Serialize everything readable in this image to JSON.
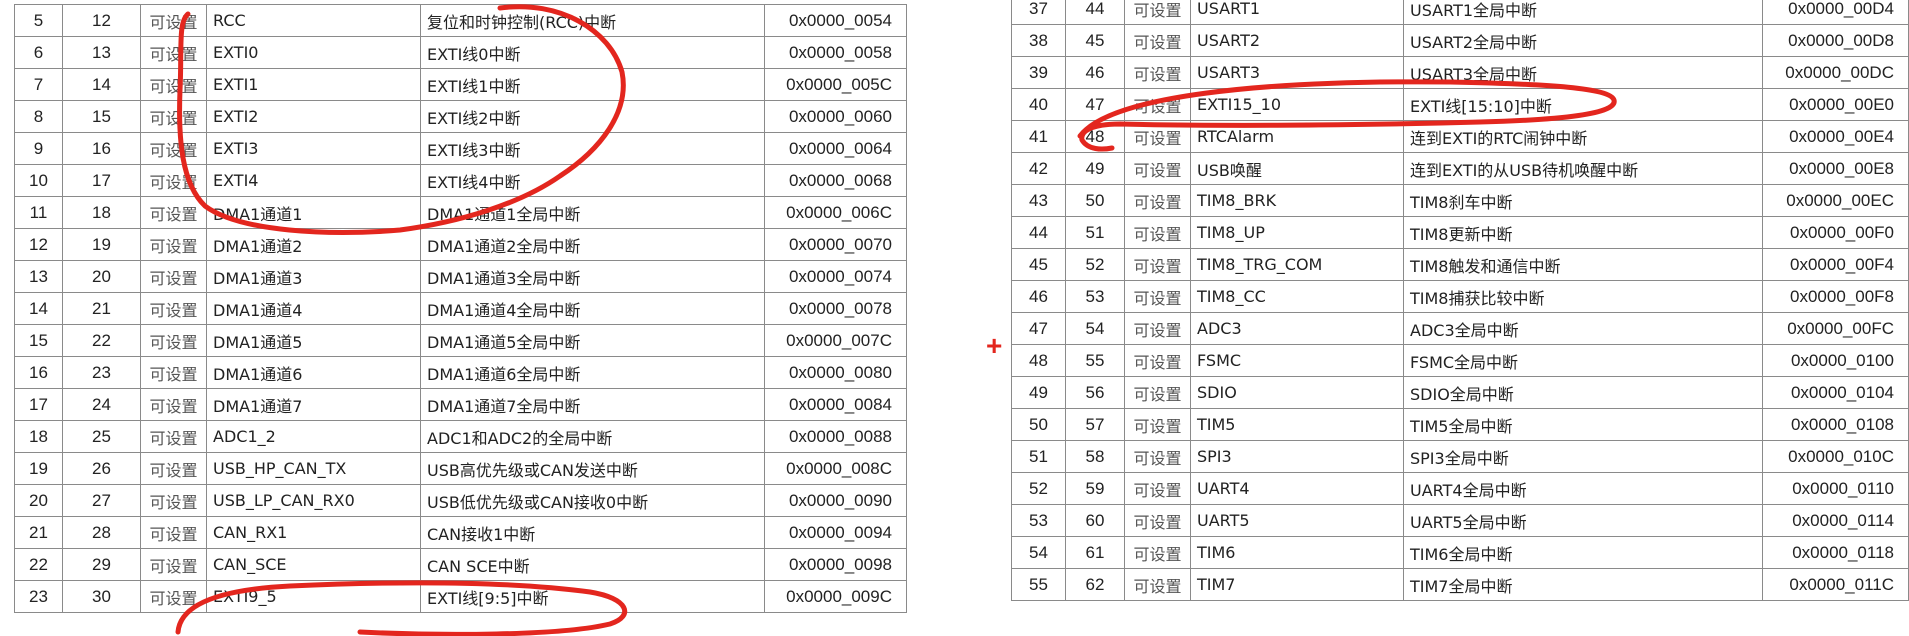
{
  "left_table": {
    "rows": [
      {
        "pos": "5",
        "prio": "12",
        "type": "可设置",
        "name": "RCC",
        "desc": "复位和时钟控制(RCC)中断",
        "addr": "0x0000_0054"
      },
      {
        "pos": "6",
        "prio": "13",
        "type": "可设置",
        "name": "EXTI0",
        "desc": "EXTI线0中断",
        "addr": "0x0000_0058"
      },
      {
        "pos": "7",
        "prio": "14",
        "type": "可设置",
        "name": "EXTI1",
        "desc": "EXTI线1中断",
        "addr": "0x0000_005C"
      },
      {
        "pos": "8",
        "prio": "15",
        "type": "可设置",
        "name": "EXTI2",
        "desc": "EXTI线2中断",
        "addr": "0x0000_0060"
      },
      {
        "pos": "9",
        "prio": "16",
        "type": "可设置",
        "name": "EXTI3",
        "desc": "EXTI线3中断",
        "addr": "0x0000_0064"
      },
      {
        "pos": "10",
        "prio": "17",
        "type": "可设置",
        "name": "EXTI4",
        "desc": "EXTI线4中断",
        "addr": "0x0000_0068"
      },
      {
        "pos": "11",
        "prio": "18",
        "type": "可设置",
        "name": "DMA1通道1",
        "desc": "DMA1通道1全局中断",
        "addr": "0x0000_006C"
      },
      {
        "pos": "12",
        "prio": "19",
        "type": "可设置",
        "name": "DMA1通道2",
        "desc": "DMA1通道2全局中断",
        "addr": "0x0000_0070"
      },
      {
        "pos": "13",
        "prio": "20",
        "type": "可设置",
        "name": "DMA1通道3",
        "desc": "DMA1通道3全局中断",
        "addr": "0x0000_0074"
      },
      {
        "pos": "14",
        "prio": "21",
        "type": "可设置",
        "name": "DMA1通道4",
        "desc": "DMA1通道4全局中断",
        "addr": "0x0000_0078"
      },
      {
        "pos": "15",
        "prio": "22",
        "type": "可设置",
        "name": "DMA1通道5",
        "desc": "DMA1通道5全局中断",
        "addr": "0x0000_007C"
      },
      {
        "pos": "16",
        "prio": "23",
        "type": "可设置",
        "name": "DMA1通道6",
        "desc": "DMA1通道6全局中断",
        "addr": "0x0000_0080"
      },
      {
        "pos": "17",
        "prio": "24",
        "type": "可设置",
        "name": "DMA1通道7",
        "desc": "DMA1通道7全局中断",
        "addr": "0x0000_0084"
      },
      {
        "pos": "18",
        "prio": "25",
        "type": "可设置",
        "name": "ADC1_2",
        "desc": "ADC1和ADC2的全局中断",
        "addr": "0x0000_0088"
      },
      {
        "pos": "19",
        "prio": "26",
        "type": "可设置",
        "name": "USB_HP_CAN_TX",
        "desc": "USB高优先级或CAN发送中断",
        "addr": "0x0000_008C"
      },
      {
        "pos": "20",
        "prio": "27",
        "type": "可设置",
        "name": "USB_LP_CAN_RX0",
        "desc": "USB低优先级或CAN接收0中断",
        "addr": "0x0000_0090"
      },
      {
        "pos": "21",
        "prio": "28",
        "type": "可设置",
        "name": "CAN_RX1",
        "desc": "CAN接收1中断",
        "addr": "0x0000_0094"
      },
      {
        "pos": "22",
        "prio": "29",
        "type": "可设置",
        "name": "CAN_SCE",
        "desc": "CAN SCE中断",
        "addr": "0x0000_0098"
      },
      {
        "pos": "23",
        "prio": "30",
        "type": "可设置",
        "name": "EXTI9_5",
        "desc": "EXTI线[9:5]中断",
        "addr": "0x0000_009C"
      }
    ]
  },
  "right_table": {
    "rows": [
      {
        "pos": "37",
        "prio": "44",
        "type": "可设置",
        "name": "USART1",
        "desc": "USART1全局中断",
        "addr": "0x0000_00D4"
      },
      {
        "pos": "38",
        "prio": "45",
        "type": "可设置",
        "name": "USART2",
        "desc": "USART2全局中断",
        "addr": "0x0000_00D8"
      },
      {
        "pos": "39",
        "prio": "46",
        "type": "可设置",
        "name": "USART3",
        "desc": "USART3全局中断",
        "addr": "0x0000_00DC"
      },
      {
        "pos": "40",
        "prio": "47",
        "type": "可设置",
        "name": "EXTI15_10",
        "desc": "EXTI线[15:10]中断",
        "addr": "0x0000_00E0"
      },
      {
        "pos": "41",
        "prio": "48",
        "type": "可设置",
        "name": "RTCAlarm",
        "desc": "连到EXTI的RTC闹钟中断",
        "addr": "0x0000_00E4"
      },
      {
        "pos": "42",
        "prio": "49",
        "type": "可设置",
        "name": "USB唤醒",
        "desc": "连到EXTI的从USB待机唤醒中断",
        "addr": "0x0000_00E8"
      },
      {
        "pos": "43",
        "prio": "50",
        "type": "可设置",
        "name": "TIM8_BRK",
        "desc": "TIM8刹车中断",
        "addr": "0x0000_00EC"
      },
      {
        "pos": "44",
        "prio": "51",
        "type": "可设置",
        "name": "TIM8_UP",
        "desc": "TIM8更新中断",
        "addr": "0x0000_00F0"
      },
      {
        "pos": "45",
        "prio": "52",
        "type": "可设置",
        "name": "TIM8_TRG_COM",
        "desc": "TIM8触发和通信中断",
        "addr": "0x0000_00F4"
      },
      {
        "pos": "46",
        "prio": "53",
        "type": "可设置",
        "name": "TIM8_CC",
        "desc": "TIM8捕获比较中断",
        "addr": "0x0000_00F8"
      },
      {
        "pos": "47",
        "prio": "54",
        "type": "可设置",
        "name": "ADC3",
        "desc": "ADC3全局中断",
        "addr": "0x0000_00FC"
      },
      {
        "pos": "48",
        "prio": "55",
        "type": "可设置",
        "name": "FSMC",
        "desc": "FSMC全局中断",
        "addr": "0x0000_0100"
      },
      {
        "pos": "49",
        "prio": "56",
        "type": "可设置",
        "name": "SDIO",
        "desc": "SDIO全局中断",
        "addr": "0x0000_0104"
      },
      {
        "pos": "50",
        "prio": "57",
        "type": "可设置",
        "name": "TIM5",
        "desc": "TIM5全局中断",
        "addr": "0x0000_0108"
      },
      {
        "pos": "51",
        "prio": "58",
        "type": "可设置",
        "name": "SPI3",
        "desc": "SPI3全局中断",
        "addr": "0x0000_010C"
      },
      {
        "pos": "52",
        "prio": "59",
        "type": "可设置",
        "name": "UART4",
        "desc": "UART4全局中断",
        "addr": "0x0000_0110"
      },
      {
        "pos": "53",
        "prio": "60",
        "type": "可设置",
        "name": "UART5",
        "desc": "UART5全局中断",
        "addr": "0x0000_0114"
      },
      {
        "pos": "54",
        "prio": "61",
        "type": "可设置",
        "name": "TIM6",
        "desc": "TIM6全局中断",
        "addr": "0x0000_0118"
      },
      {
        "pos": "55",
        "prio": "62",
        "type": "可设置",
        "name": "TIM7",
        "desc": "TIM7全局中断",
        "addr": "0x0000_011C"
      }
    ]
  },
  "annotation": {
    "ink_color": "#e3261e",
    "marker_glyph": "+"
  }
}
